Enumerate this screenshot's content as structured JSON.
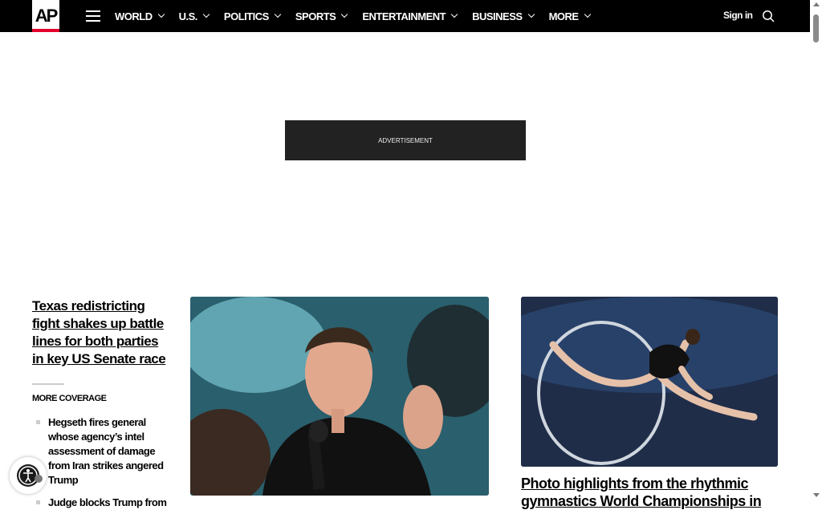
{
  "header": {
    "logo": "AP",
    "nav": [
      {
        "label": "WORLD"
      },
      {
        "label": "U.S."
      },
      {
        "label": "POLITICS"
      },
      {
        "label": "SPORTS"
      },
      {
        "label": "ENTERTAINMENT"
      },
      {
        "label": "BUSINESS"
      },
      {
        "label": "MORE"
      }
    ],
    "sign_in": "Sign in"
  },
  "ad": {
    "label": "ADVERTISEMENT"
  },
  "lead": {
    "title": "Texas redistricting fight shakes up battle lines for both parties in key US Senate race",
    "more_coverage": "MORE COVERAGE",
    "related": [
      {
        "title": "Hegseth fires general whose agency’s intel assessment of damage from Iran strikes angered Trump"
      },
      {
        "title": "Judge blocks Trump from"
      }
    ]
  },
  "side_story": {
    "title": "Photo highlights from the rhythmic gymnastics World Championships in"
  },
  "colors": {
    "brand_red": "#e4002b",
    "nav_bg": "#000000"
  }
}
